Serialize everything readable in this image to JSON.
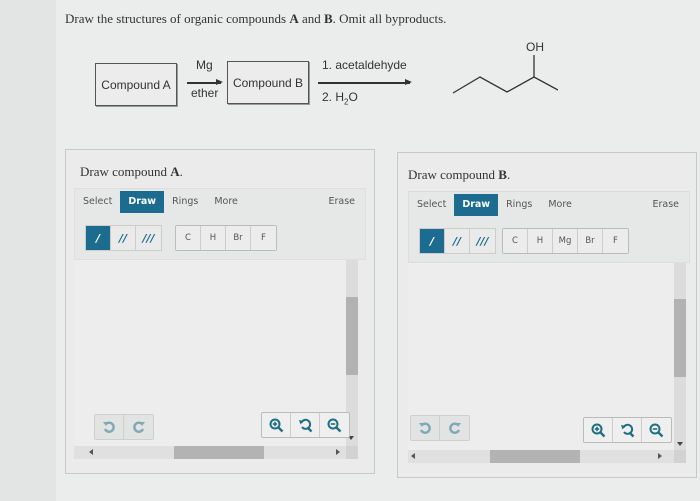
{
  "question": {
    "prefix": "Draw the structures of organic compounds ",
    "a": "A",
    "and": " and ",
    "b": "B",
    "suffix": ". Omit all byproducts."
  },
  "scheme": {
    "compound_a": "Compound A",
    "compound_b": "Compound B",
    "step1_above": "Mg",
    "step1_below": "ether",
    "step2_above": "1. acetaldehyde",
    "step2_below_prefix": "2. H",
    "step2_below_sub": "2",
    "step2_below_suffix": "O",
    "product_label": "OH"
  },
  "panels": [
    {
      "title_prefix": "Draw compound ",
      "title_bold": "A",
      "title_suffix": ".",
      "tabs": [
        "Select",
        "Draw",
        "Rings",
        "More"
      ],
      "active_tab": "Draw",
      "erase": "Erase",
      "bonds": [
        "/",
        "//",
        "///"
      ],
      "atoms": [
        "C",
        "H",
        "Br",
        "F"
      ]
    },
    {
      "title_prefix": "Draw compound ",
      "title_bold": "B",
      "title_suffix": ".",
      "tabs": [
        "Select",
        "Draw",
        "Rings",
        "More"
      ],
      "active_tab": "Draw",
      "erase": "Erase",
      "bonds": [
        "/",
        "//",
        "///"
      ],
      "atoms": [
        "C",
        "H",
        "Mg",
        "Br",
        "F"
      ]
    }
  ],
  "colors": {
    "accent": "#1b6c8f",
    "icon_teal": "#1f6f80",
    "history_icon": "#7fa9b4"
  }
}
